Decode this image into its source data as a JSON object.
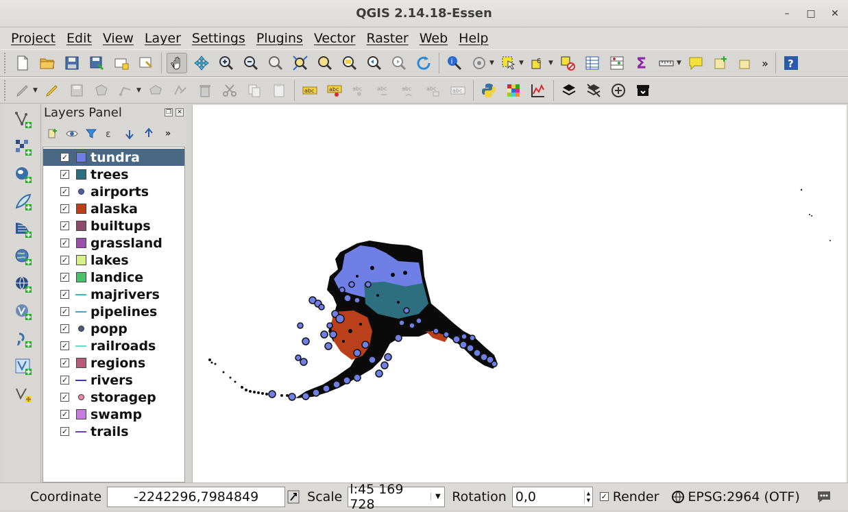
{
  "window": {
    "title": "QGIS 2.14.18-Essen",
    "controls": [
      "–",
      "□",
      "✕"
    ]
  },
  "menu": [
    "Project",
    "Edit",
    "View",
    "Layer",
    "Settings",
    "Plugins",
    "Vector",
    "Raster",
    "Web",
    "Help"
  ],
  "toolbar_overflow": "»",
  "layers_panel": {
    "title": "Layers Panel",
    "overflow": "»",
    "layers": [
      {
        "name": "tundra",
        "checked": true,
        "symbol": "fill",
        "color": "#6f7fe6",
        "selected": true
      },
      {
        "name": "trees",
        "checked": true,
        "symbol": "fill",
        "color": "#2d6f7f"
      },
      {
        "name": "airports",
        "checked": true,
        "symbol": "point",
        "color": "#4f5fa8"
      },
      {
        "name": "alaska",
        "checked": true,
        "symbol": "fill",
        "color": "#b9401a"
      },
      {
        "name": "builtups",
        "checked": true,
        "symbol": "fill",
        "color": "#8a4a6a"
      },
      {
        "name": "grassland",
        "checked": true,
        "symbol": "fill",
        "color": "#9a4fa8"
      },
      {
        "name": "lakes",
        "checked": true,
        "symbol": "fill",
        "color": "#d8f08a"
      },
      {
        "name": "landice",
        "checked": true,
        "symbol": "fill",
        "color": "#4cc06a"
      },
      {
        "name": "majrivers",
        "checked": true,
        "symbol": "line",
        "color": "#3ab8c8"
      },
      {
        "name": "pipelines",
        "checked": true,
        "symbol": "line",
        "color": "#3aa8c8"
      },
      {
        "name": "popp",
        "checked": true,
        "symbol": "point",
        "color": "#4a5a7a"
      },
      {
        "name": "railroads",
        "checked": true,
        "symbol": "line",
        "color": "#6ad8c8"
      },
      {
        "name": "regions",
        "checked": true,
        "symbol": "fill",
        "color": "#b85a7a"
      },
      {
        "name": "rivers",
        "checked": true,
        "symbol": "line",
        "color": "#3a3aa8"
      },
      {
        "name": "storagep",
        "checked": true,
        "symbol": "point",
        "color": "#e88aa8"
      },
      {
        "name": "swamp",
        "checked": true,
        "symbol": "fill",
        "color": "#c87ae0"
      },
      {
        "name": "trails",
        "checked": true,
        "symbol": "line",
        "color": "#7a3ab8"
      }
    ]
  },
  "status": {
    "coordinate_label": "Coordinate",
    "coordinate_value": "-2242296,7984849",
    "scale_label": "Scale",
    "scale_value": "l:45 169 728",
    "rotation_label": "Rotation",
    "rotation_value": "0,0",
    "render_label": "Render",
    "render_checked": true,
    "crs": "EPSG:2964 (OTF)"
  },
  "icons": {
    "main_toolbar": [
      "new-project-icon",
      "open-project-icon",
      "save-project-icon",
      "save-as-icon",
      "new-print-composer-icon",
      "composer-manager-icon",
      "pan-icon",
      "pan-to-selection-icon",
      "zoom-in-icon",
      "zoom-out-icon",
      "zoom-actual-icon",
      "zoom-full-icon",
      "zoom-to-selection-icon",
      "zoom-to-layer-icon",
      "zoom-last-icon",
      "zoom-next-icon",
      "refresh-icon",
      "identify-icon",
      "run-action-icon",
      "select-features-icon",
      "select-by-expression-icon",
      "deselect-icon",
      "attribute-table-icon",
      "statistics-icon",
      "sum-icon",
      "measure-icon",
      "map-tips-icon",
      "new-bookmark-icon",
      "show-bookmarks-icon",
      "help-icon"
    ],
    "digitize_toolbar": [
      "current-edits-icon",
      "toggle-editing-icon",
      "save-edits-icon",
      "add-feature-icon",
      "move-feature-icon",
      "node-tool-icon",
      "delete-selected-icon",
      "cut-features-icon",
      "copy-features-icon",
      "paste-features-icon",
      "label-icon",
      "pin-labels-icon",
      "show-hide-labels-icon",
      "move-label-icon",
      "rotate-label-icon",
      "change-label-icon",
      "python-console-icon",
      "raster-calculator-icon",
      "profile-tool-icon",
      "layers-icon",
      "layers-off-icon",
      "add-circle-icon",
      "archive-icon"
    ],
    "left_toolbar": [
      "add-vector-layer-icon",
      "add-raster-layer-icon",
      "add-postgis-layer-icon",
      "add-spatialite-layer-icon",
      "add-mssql-layer-icon",
      "add-wms-layer-icon",
      "add-wcs-layer-icon",
      "add-wfs-layer-icon",
      "add-delimited-text-icon",
      "add-virtual-layer-icon",
      "new-shapefile-layer-icon"
    ]
  }
}
